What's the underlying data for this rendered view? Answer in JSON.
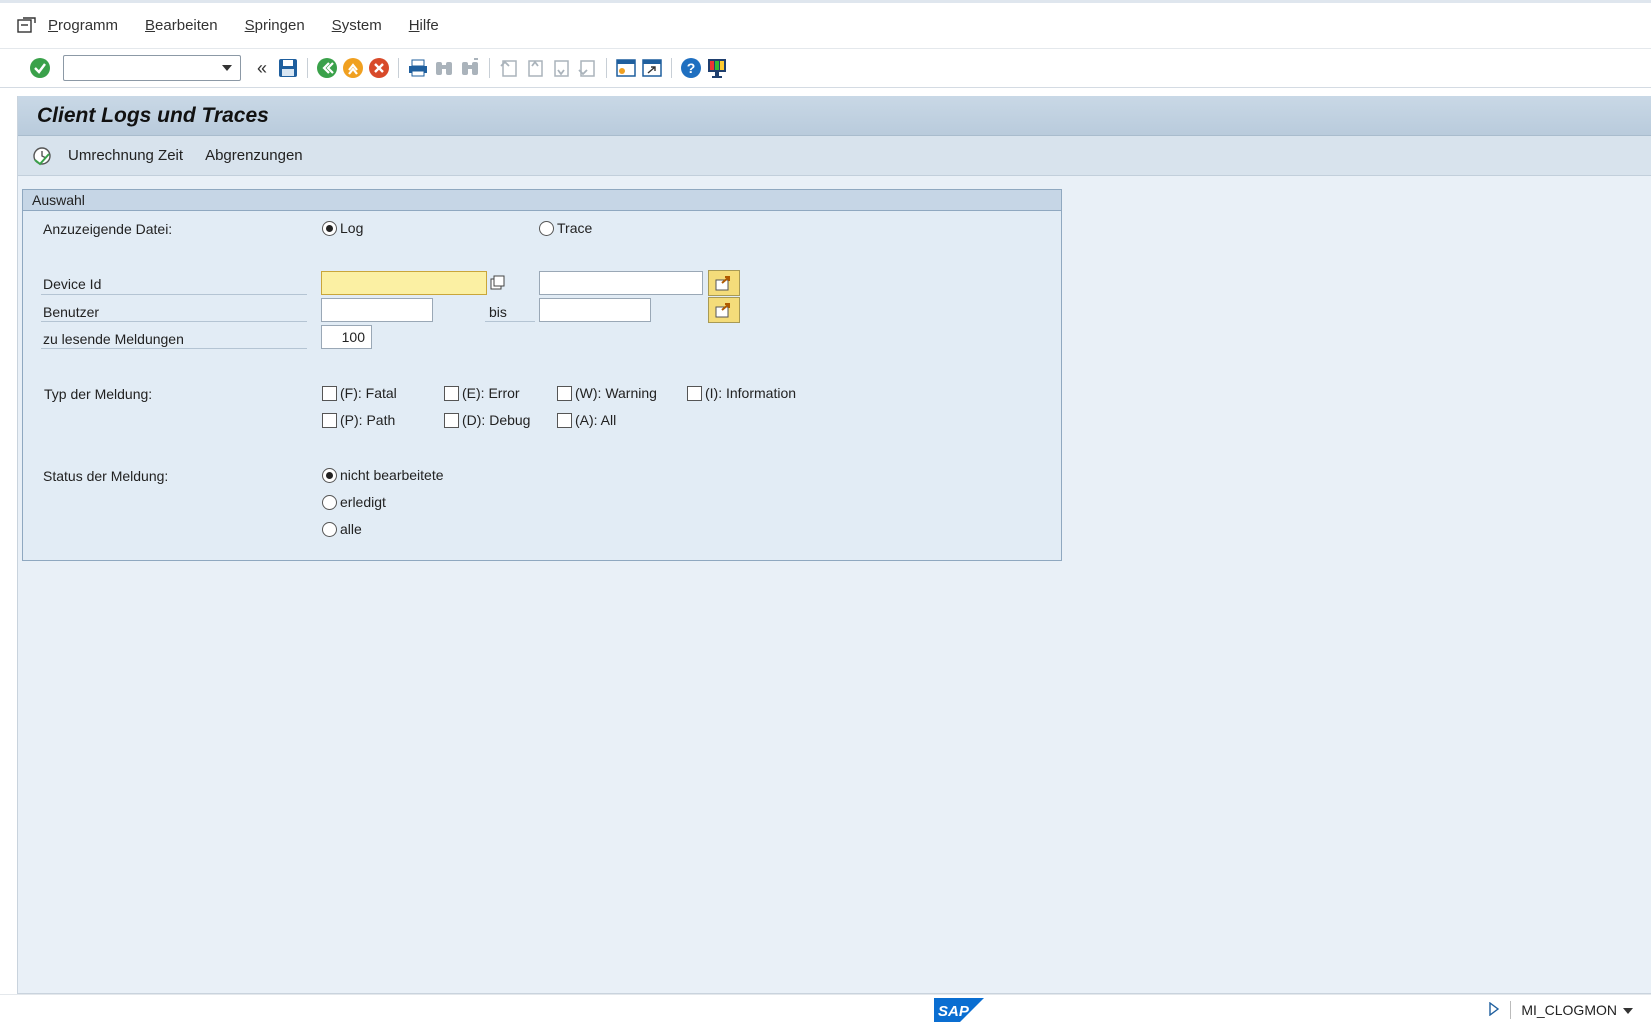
{
  "menubar": {
    "items": [
      {
        "label_first": "P",
        "label_rest": "rogramm"
      },
      {
        "label_first": "B",
        "label_rest": "earbeiten"
      },
      {
        "label_first": "S",
        "label_rest": "pringen"
      },
      {
        "label_first": "S",
        "label_rest": "ystem"
      },
      {
        "label_first": "H",
        "label_rest": "ilfe"
      }
    ]
  },
  "toolbar": {
    "command_field": {
      "value": ""
    },
    "icons": [
      "enter-icon",
      "back-double-icon",
      "save-icon",
      "back-icon",
      "exit-icon",
      "cancel-icon",
      "print-icon",
      "find-icon",
      "find-next-icon",
      "first-page-icon",
      "previous-page-icon",
      "next-page-icon",
      "last-page-icon",
      "new-session-icon",
      "shortcut-icon",
      "help-icon",
      "customize-layout-icon"
    ]
  },
  "screen": {
    "title": "Client Logs und Traces",
    "app_toolbar": {
      "convert_time": "Umrechnung Zeit",
      "restrictions": "Abgrenzungen"
    }
  },
  "selection": {
    "group_title": "Auswahl",
    "file_label": "Anzuzeigende Datei:",
    "file_options": {
      "log": "Log",
      "trace": "Trace",
      "selected": "log"
    },
    "device_id": {
      "label": "Device Id",
      "from": "",
      "to": ""
    },
    "user": {
      "label": "Benutzer",
      "from": "",
      "to_label": "bis",
      "to": ""
    },
    "messages_to_read": {
      "label": "zu lesende Meldungen",
      "value": "100"
    },
    "type": {
      "label": "Typ der Meldung:",
      "fatal": "(F): Fatal",
      "error": "(E): Error",
      "warning": "(W): Warning",
      "information": "(I): Information",
      "path": "(P): Path",
      "debug": "(D): Debug",
      "all": "(A): All"
    },
    "status": {
      "label": "Status der Meldung:",
      "unprocessed": "nicht bearbeitete",
      "done": "erledigt",
      "all": "alle",
      "selected": "unprocessed"
    }
  },
  "footer": {
    "logo": "SAP",
    "transaction": "MI_CLOGMON"
  },
  "colors": {
    "accent": "#0a6ed1",
    "focus_field": "#fbf0a3",
    "select_button": "#f4dc7a"
  }
}
